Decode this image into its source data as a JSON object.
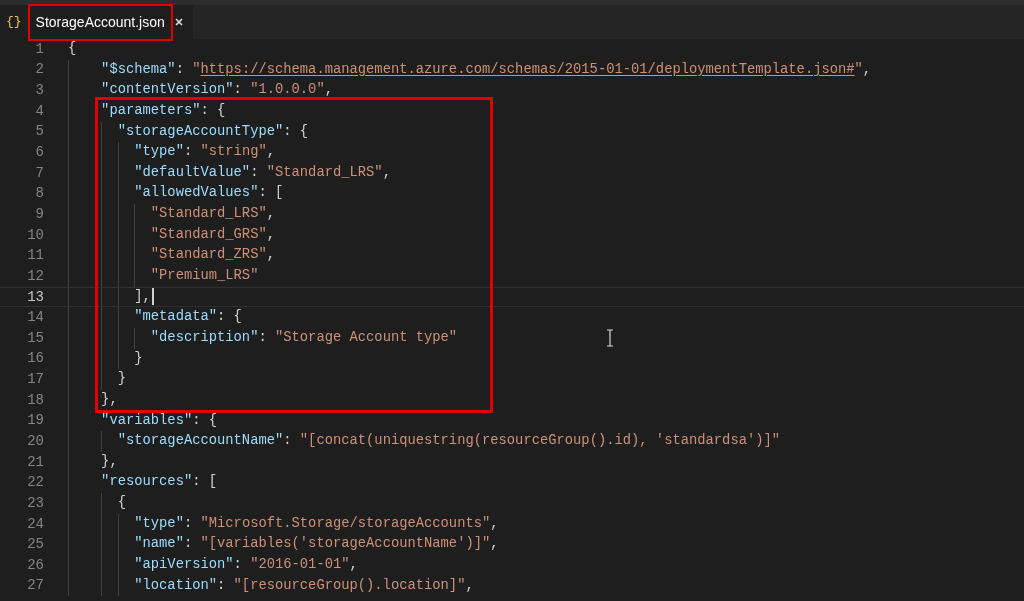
{
  "tab": {
    "icon": "{}",
    "title": "StorageAccount.json",
    "selected": true,
    "highlighted": true
  },
  "editor": {
    "blocks": [
      {
        "kind": "plain",
        "lines": [
          {
            "number": "1",
            "current": false,
            "tokens": [
              {
                "kind": "punct",
                "text": "{"
              }
            ]
          },
          {
            "number": "2",
            "current": false,
            "tokens": [
              {
                "kind": "key",
                "text": "    \"$schema\""
              },
              {
                "kind": "punct",
                "text": ": "
              },
              {
                "kind": "string",
                "text": "\""
              },
              {
                "kind": "link",
                "text": "https://schema.management.azure.com/schemas/2015-01-01/deploymentTemplate.json#"
              },
              {
                "kind": "string",
                "text": "\""
              },
              {
                "kind": "punct",
                "text": ","
              }
            ]
          },
          {
            "number": "3",
            "current": false,
            "tokens": [
              {
                "kind": "key",
                "text": "    \"contentVersion\""
              },
              {
                "kind": "punct",
                "text": ": "
              },
              {
                "kind": "string",
                "text": "\"1.0.0.0\""
              },
              {
                "kind": "punct",
                "text": ","
              }
            ]
          }
        ]
      },
      {
        "kind": "framed",
        "lines": [
          {
            "number": "4",
            "current": false,
            "tokens": [
              {
                "kind": "key",
                "text": "    \"parameters\""
              },
              {
                "kind": "punct",
                "text": ": {"
              }
            ]
          },
          {
            "number": "5",
            "current": false,
            "tokens": [
              {
                "kind": "key",
                "text": "      \"storageAccountType\""
              },
              {
                "kind": "punct",
                "text": ": {"
              }
            ]
          },
          {
            "number": "6",
            "current": false,
            "tokens": [
              {
                "kind": "key",
                "text": "        \"type\""
              },
              {
                "kind": "punct",
                "text": ": "
              },
              {
                "kind": "string",
                "text": "\"string\""
              },
              {
                "kind": "punct",
                "text": ","
              }
            ]
          },
          {
            "number": "7",
            "current": false,
            "tokens": [
              {
                "kind": "key",
                "text": "        \"defaultValue\""
              },
              {
                "kind": "punct",
                "text": ": "
              },
              {
                "kind": "string",
                "text": "\"Standard_LRS\""
              },
              {
                "kind": "punct",
                "text": ","
              }
            ]
          },
          {
            "number": "8",
            "current": false,
            "tokens": [
              {
                "kind": "key",
                "text": "        \"allowedValues\""
              },
              {
                "kind": "punct",
                "text": ": ["
              }
            ]
          },
          {
            "number": "9",
            "current": false,
            "tokens": [
              {
                "kind": "string",
                "text": "          \"Standard_LRS\""
              },
              {
                "kind": "punct",
                "text": ","
              }
            ]
          },
          {
            "number": "10",
            "current": false,
            "tokens": [
              {
                "kind": "string",
                "text": "          \"Standard_GRS\""
              },
              {
                "kind": "punct",
                "text": ","
              }
            ]
          },
          {
            "number": "11",
            "current": false,
            "tokens": [
              {
                "kind": "string",
                "text": "          \"Standard_ZRS\""
              },
              {
                "kind": "punct",
                "text": ","
              }
            ]
          },
          {
            "number": "12",
            "current": false,
            "tokens": [
              {
                "kind": "string",
                "text": "          \"Premium_LRS\""
              }
            ]
          },
          {
            "number": "13",
            "current": true,
            "tokens": [
              {
                "kind": "punct",
                "text": "        ],"
              }
            ]
          },
          {
            "number": "14",
            "current": false,
            "tokens": [
              {
                "kind": "key",
                "text": "        \"metadata\""
              },
              {
                "kind": "punct",
                "text": ": {"
              }
            ]
          },
          {
            "number": "15",
            "current": false,
            "tokens": [
              {
                "kind": "key",
                "text": "          \"description\""
              },
              {
                "kind": "punct",
                "text": ": "
              },
              {
                "kind": "string",
                "text": "\"Storage Account type\""
              }
            ]
          },
          {
            "number": "16",
            "current": false,
            "tokens": [
              {
                "kind": "punct",
                "text": "        }"
              }
            ]
          },
          {
            "number": "17",
            "current": false,
            "tokens": [
              {
                "kind": "punct",
                "text": "      }"
              }
            ]
          },
          {
            "number": "18",
            "current": false,
            "tokens": [
              {
                "kind": "punct",
                "text": "    },"
              }
            ]
          }
        ]
      },
      {
        "kind": "plain",
        "lines": [
          {
            "number": "19",
            "current": false,
            "tokens": [
              {
                "kind": "key",
                "text": "    \"variables\""
              },
              {
                "kind": "punct",
                "text": ": {"
              }
            ]
          },
          {
            "number": "20",
            "current": false,
            "tokens": [
              {
                "kind": "key",
                "text": "      \"storageAccountName\""
              },
              {
                "kind": "punct",
                "text": ": "
              },
              {
                "kind": "string",
                "text": "\"[concat(uniquestring(resourceGroup().id), 'standardsa')]\""
              }
            ]
          },
          {
            "number": "21",
            "current": false,
            "tokens": [
              {
                "kind": "punct",
                "text": "    },"
              }
            ]
          },
          {
            "number": "22",
            "current": false,
            "tokens": [
              {
                "kind": "key",
                "text": "    \"resources\""
              },
              {
                "kind": "punct",
                "text": ": ["
              }
            ]
          },
          {
            "number": "23",
            "current": false,
            "tokens": [
              {
                "kind": "punct",
                "text": "      {"
              }
            ]
          },
          {
            "number": "24",
            "current": false,
            "tokens": [
              {
                "kind": "key",
                "text": "        \"type\""
              },
              {
                "kind": "punct",
                "text": ": "
              },
              {
                "kind": "string",
                "text": "\"Microsoft.Storage/storageAccounts\""
              },
              {
                "kind": "punct",
                "text": ","
              }
            ]
          },
          {
            "number": "25",
            "current": false,
            "tokens": [
              {
                "kind": "key",
                "text": "        \"name\""
              },
              {
                "kind": "punct",
                "text": ": "
              },
              {
                "kind": "string",
                "text": "\"[variables('storageAccountName')]\""
              },
              {
                "kind": "punct",
                "text": ","
              }
            ]
          },
          {
            "number": "26",
            "current": false,
            "tokens": [
              {
                "kind": "key",
                "text": "        \"apiVersion\""
              },
              {
                "kind": "punct",
                "text": ": "
              },
              {
                "kind": "string",
                "text": "\"2016-01-01\""
              },
              {
                "kind": "punct",
                "text": ","
              }
            ]
          },
          {
            "number": "27",
            "current": false,
            "tokens": [
              {
                "kind": "key",
                "text": "        \"location\""
              },
              {
                "kind": "punct",
                "text": ": "
              },
              {
                "kind": "string",
                "text": "\"[resourceGroup().location]\""
              },
              {
                "kind": "punct",
                "text": ","
              }
            ]
          }
        ]
      }
    ]
  }
}
